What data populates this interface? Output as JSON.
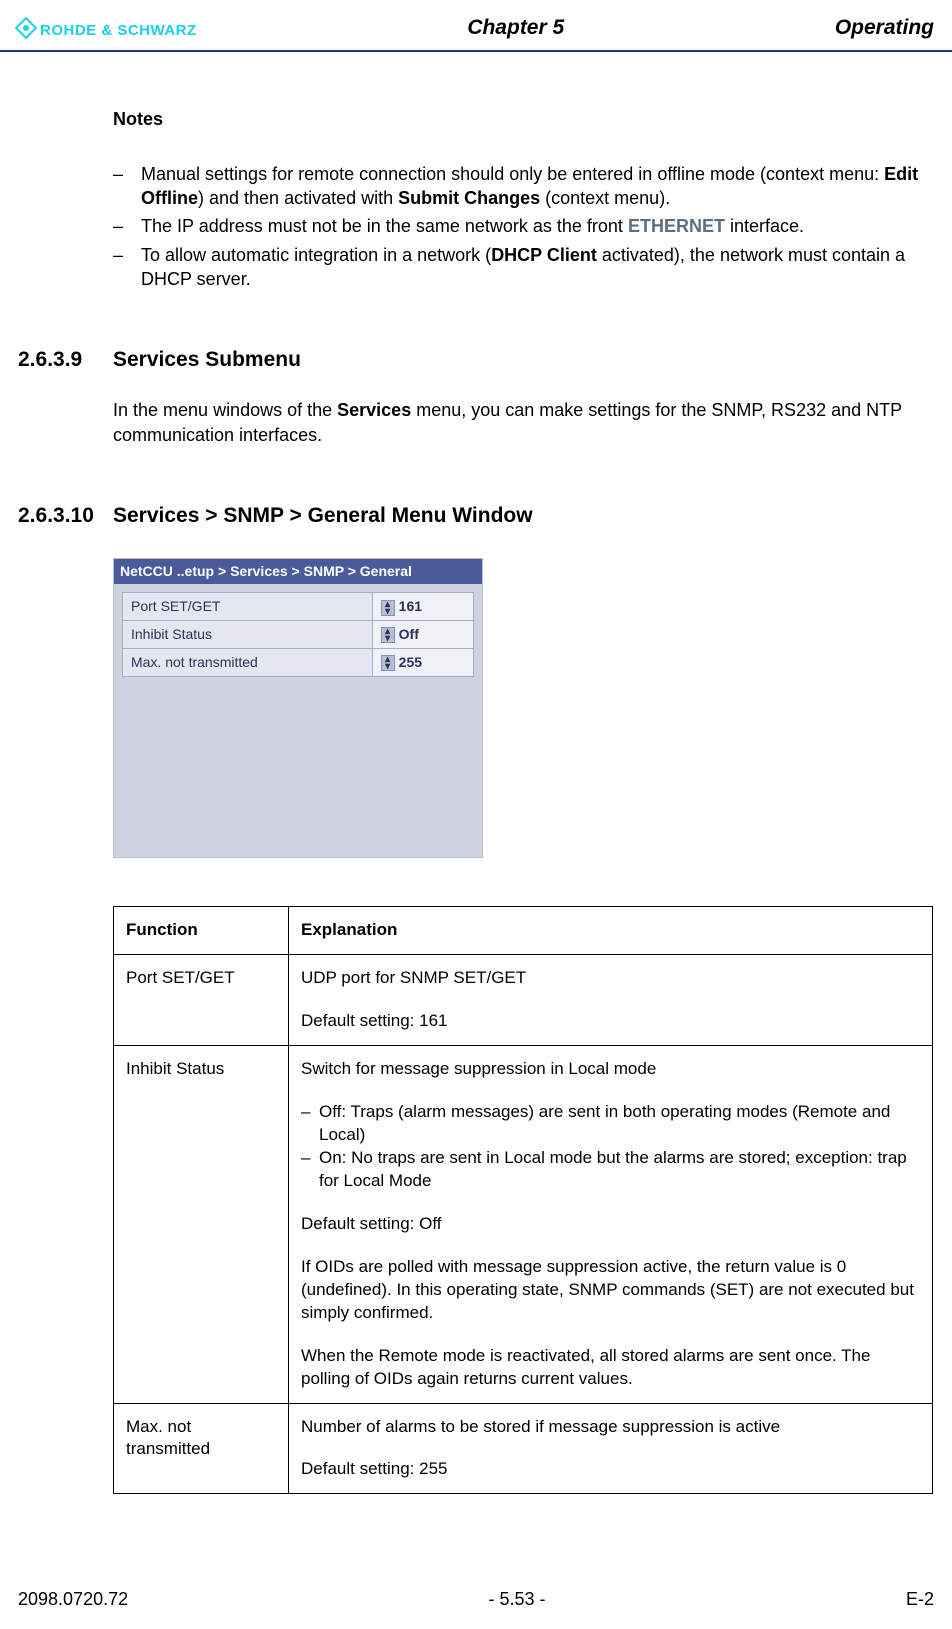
{
  "header": {
    "logo_text": "ROHDE & SCHWARZ",
    "center": "Chapter 5",
    "right": "Operating"
  },
  "notes": {
    "heading": "Notes",
    "items": [
      {
        "pre": "Manual settings for remote connection should only be entered in offline mode (context menu: ",
        "b1": "Edit Offline",
        "mid": ") and then activated with ",
        "b2": "Submit Changes",
        "post": " (context menu)."
      },
      {
        "pre": "The IP address must not be in the same network as the front ",
        "eth": "ETHERNET",
        "post": " interface."
      },
      {
        "pre": "To allow automatic integration in a network (",
        "b1": "DHCP Client",
        "mid": " activated), the network must contain a DHCP server."
      }
    ]
  },
  "sec1": {
    "num": "2.6.3.9",
    "title": "Services Submenu",
    "body_pre": "In the menu windows of the ",
    "body_b": "Services",
    "body_post": " menu, you can make settings for the SNMP, RS232 and NTP communication interfaces."
  },
  "sec2": {
    "num": "2.6.3.10",
    "title": "Services > SNMP > General Menu Window"
  },
  "screenshot": {
    "titlebar": "NetCCU ..etup > Services > SNMP > General",
    "rows": [
      {
        "label": "Port SET/GET",
        "value": "161"
      },
      {
        "label": "Inhibit Status",
        "value": "Off"
      },
      {
        "label": "Max. not transmitted",
        "value": "255"
      }
    ]
  },
  "table": {
    "h1": "Function",
    "h2": "Explanation",
    "rows": [
      {
        "func": "Port SET/GET",
        "p1": "UDP port for SNMP SET/GET",
        "p2": "Default setting: 161"
      },
      {
        "func": "Inhibit Status",
        "p1": "Switch for message suppression in Local mode",
        "li1": "Off: Traps (alarm messages) are sent in both operating modes (Remote and Local)",
        "li2": "On: No traps are sent in Local mode but the alarms are stored; exception: trap for Local Mode",
        "p2": "Default setting: Off",
        "p3": "If OIDs are polled with message suppression active, the return value is 0 (undefined). In this operating state, SNMP commands (SET) are not executed but simply confirmed.",
        "p4": "When the Remote mode is reactivated, all stored alarms are sent once. The polling of OIDs again returns current values."
      },
      {
        "func": "Max. not transmitted",
        "p1": "Number of alarms to be stored if message suppression is active",
        "p2": "Default setting: 255"
      }
    ]
  },
  "footer": {
    "left": "2098.0720.72",
    "center": "- 5.53 -",
    "right": "E-2"
  }
}
